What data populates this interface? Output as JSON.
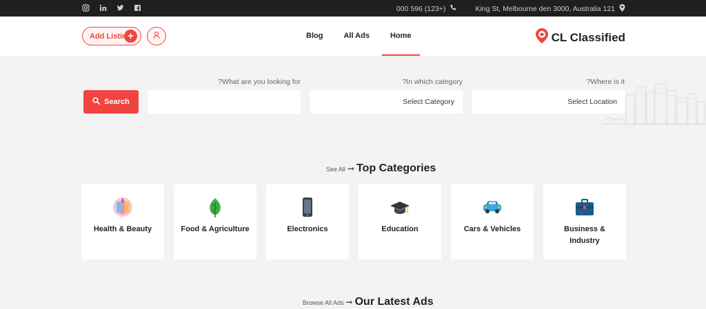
{
  "topbar": {
    "social_icons": [
      "instagram-icon",
      "linkedin-icon",
      "twitter-icon",
      "facebook-icon"
    ],
    "phone": "000 596 (123+)",
    "address": "King St, Melbourne den 3000, Australia 121"
  },
  "header": {
    "add_listing_label": "Add Listing",
    "nav": [
      "Blog",
      "All Ads",
      "Home"
    ],
    "active_nav": "Home",
    "logo_text": "CL Classified"
  },
  "search": {
    "button_label": "Search",
    "keyword_label": "?What are you looking for",
    "keyword_value": "",
    "category_label": "?In which category",
    "category_value": "Select Category",
    "location_label": "?Where is it",
    "location_value": "Select Location"
  },
  "categories": {
    "see_all": "See All",
    "title": "Top Categories",
    "items": [
      {
        "label": "Health & Beauty",
        "icon": "cosmetics-icon"
      },
      {
        "label": "Food & Agriculture",
        "icon": "leaf-icon"
      },
      {
        "label": "Electronics",
        "icon": "smartphone-icon"
      },
      {
        "label": "Education",
        "icon": "graduation-cap-icon"
      },
      {
        "label": "Cars & Vehicles",
        "icon": "car-icon"
      },
      {
        "label": "Business & Industry",
        "icon": "briefcase-icon"
      }
    ]
  },
  "latest": {
    "browse_all": "Browse All Ads",
    "title": "Our Latest Ads"
  },
  "colors": {
    "accent": "#f1443f",
    "topbar": "#1f1f1f",
    "background": "#f3f3f3"
  }
}
